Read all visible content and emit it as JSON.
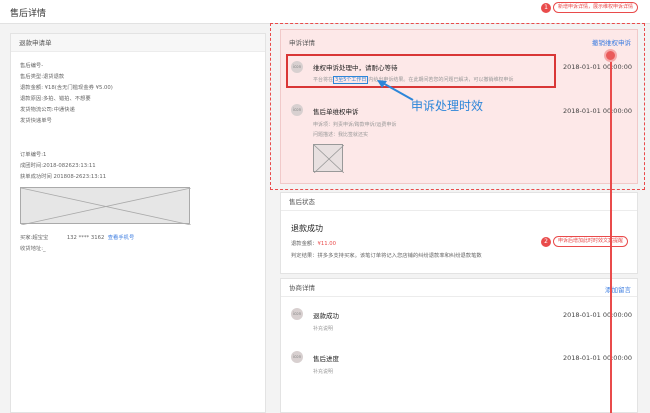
{
  "topbar": {
    "title": "售后详情"
  },
  "annotations": {
    "note1_num": "1",
    "note1_text": "新增申诉详情，展示维权申诉详情",
    "note2_num": "2",
    "note2_text": "申诉后增加此时时效文案提醒",
    "callout": "申诉处理时效"
  },
  "refund": {
    "title": "退款申请单",
    "rows": [
      "售后编号-",
      "售后类型:退货退款",
      "退款金额: ¥18(含无门槛现金券 ¥5.00)",
      "退款原因:多拍、错拍、不想要",
      "发货物流公司:中通快递",
      "发货快递单号"
    ],
    "order_rows": [
      "订单编号:1",
      "成团时间:2018-082623:13:11",
      "获单成功时间 201808-2623:13:11"
    ],
    "buyer_label": "买家:超宝宝",
    "buyer_phone": "132 **** 3162",
    "buyer_link": "查看手机号",
    "address_label": "收货地址:_"
  },
  "complaint": {
    "title": "申诉详情",
    "cancel": "撤销维权申诉",
    "item1": {
      "avatar": "icon",
      "title": "维权申诉处理中，请耐心等待",
      "sub_prefix": "平台将在",
      "sub_highlight": "3至5个工作日",
      "sub_suffix": "内给出申诉结果。在此期间若您的问题已解决，可以撤销维权申诉",
      "time": "2018-01-01 00:00:00"
    },
    "item2": {
      "avatar": "icon",
      "title": "售后单维权申诉",
      "sub1": "申诉项：判责申诉/跨款申诉/运费申诉",
      "sub2": "问题描述：我比签就还实",
      "time": "2018-01-01 00:00:00"
    }
  },
  "status": {
    "title": "售后状态",
    "result": "退款成功",
    "amount_label": "退款金额：",
    "amount_value": "¥11.00",
    "judge": "判定结果：拼多多支持买家。该笔订单将记入您店铺的纠纷退款率和纠纷退款笔数"
  },
  "nego": {
    "title": "协商详情",
    "add": "添加留言",
    "items": [
      {
        "avatar": "icon",
        "title": "退款成功",
        "sub": "补充说明",
        "time": "2018-01-01 00:00:00"
      },
      {
        "avatar": "icon",
        "title": "售后进度",
        "sub": "补充说明",
        "time": "2018-01-01 00:00:00"
      }
    ]
  }
}
